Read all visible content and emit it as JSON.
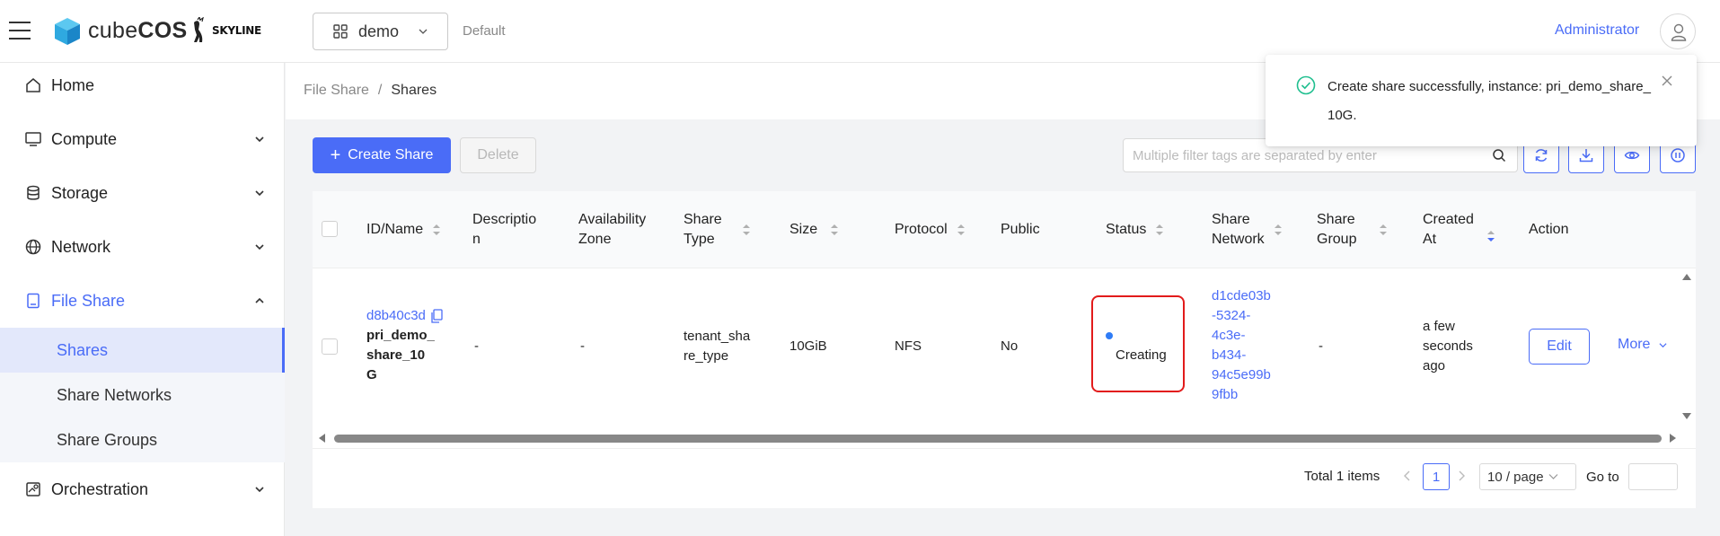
{
  "header": {
    "logo_text_a": "cube",
    "logo_text_b": "COS",
    "brand_partner": "SKYLINE",
    "project": "demo",
    "domain": "Default",
    "user": "Administrator"
  },
  "sidebar": {
    "items": [
      {
        "label": "Home",
        "icon": "home-icon"
      },
      {
        "label": "Compute",
        "icon": "monitor-icon"
      },
      {
        "label": "Storage",
        "icon": "database-icon"
      },
      {
        "label": "Network",
        "icon": "globe-icon"
      },
      {
        "label": "File Share",
        "icon": "file-share-icon"
      },
      {
        "label": "Orchestration",
        "icon": "orchestration-icon"
      }
    ],
    "sub_items": [
      "Shares",
      "Share Networks",
      "Share Groups"
    ],
    "selected_sub": "Shares"
  },
  "breadcrumb": {
    "parent": "File Share",
    "separator": "/",
    "current": "Shares"
  },
  "toolbar": {
    "create_label": "Create Share",
    "delete_label": "Delete",
    "search_placeholder": "Multiple filter tags are separated by enter"
  },
  "table": {
    "columns": [
      {
        "line1": "ID/Name",
        "line2": ""
      },
      {
        "line1": "Descriptio",
        "line2": "n"
      },
      {
        "line1": "Availability",
        "line2": "Zone"
      },
      {
        "line1": "Share",
        "line2": "Type"
      },
      {
        "line1": "Size",
        "line2": ""
      },
      {
        "line1": "Protocol",
        "line2": ""
      },
      {
        "line1": "Public",
        "line2": ""
      },
      {
        "line1": "Status",
        "line2": ""
      },
      {
        "line1": "Share",
        "line2": "Network"
      },
      {
        "line1": "Share",
        "line2": "Group"
      },
      {
        "line1": "Created",
        "line2": "At"
      },
      {
        "line1": "Action",
        "line2": ""
      }
    ],
    "rows": [
      {
        "id": "d8b40c3d",
        "name_lines": [
          "pri_demo_",
          "share_10",
          "G"
        ],
        "description": "-",
        "availability_zone": "-",
        "share_type_lines": [
          "tenant_sha",
          "re_type"
        ],
        "size": "10GiB",
        "protocol": "NFS",
        "public": "No",
        "status": "Creating",
        "share_network_lines": [
          "d1cde03b",
          "-5324-",
          "4c3e-",
          "b434-",
          "94c5e99b",
          "9fbb"
        ],
        "share_group": "-",
        "created_at_lines": [
          "a few",
          "seconds",
          "ago"
        ],
        "edit_label": "Edit",
        "more_label": "More"
      }
    ]
  },
  "pagination": {
    "total": "Total 1 items",
    "page": "1",
    "page_size": "10 / page",
    "goto_label": "Go to"
  },
  "notification": {
    "message": "Create share successfully, instance: pri_demo_share_10G."
  },
  "colors": {
    "accent": "#4a6cf7",
    "success": "#1fbf8f",
    "status_dot": "#2f7cf6",
    "highlight": "#e21b1b"
  }
}
